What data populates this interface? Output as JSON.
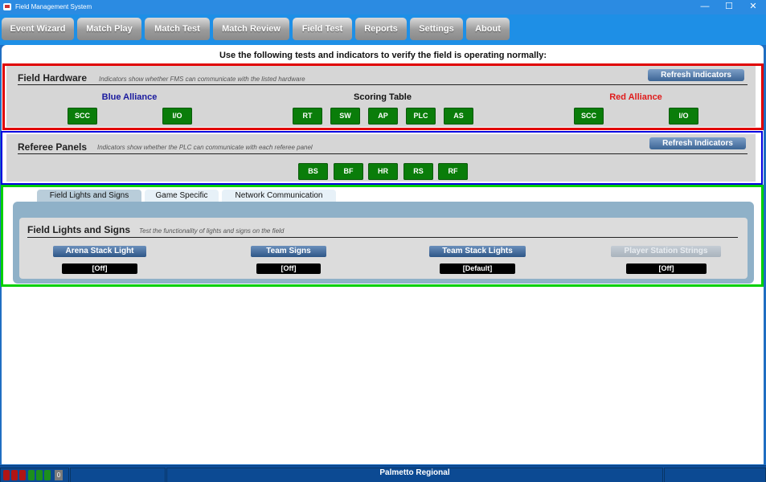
{
  "window": {
    "title": "Field Management System",
    "minimize_glyph": "—",
    "maximize_glyph": "☐",
    "close_glyph": "✕"
  },
  "nav": {
    "items": [
      "Event Wizard",
      "Match Play",
      "Match Test",
      "Match Review",
      "Field Test",
      "Reports",
      "Settings",
      "About"
    ],
    "active": "Field Test"
  },
  "instructions": "Use the following tests and indicators to verify the field is operating normally:",
  "field_hardware": {
    "title": "Field Hardware",
    "subtitle": "Indicators show whether FMS can communicate with the listed hardware",
    "refresh_label": "Refresh Indicators",
    "blue_alliance": {
      "label": "Blue Alliance",
      "color": "#1a1a9e",
      "indicators": [
        "SCC",
        "I/O"
      ]
    },
    "scoring_table": {
      "label": "Scoring Table",
      "indicators": [
        "RT",
        "SW",
        "AP",
        "PLC",
        "AS"
      ]
    },
    "red_alliance": {
      "label": "Red Alliance",
      "color": "#e01b1b",
      "indicators": [
        "SCC",
        "I/O"
      ]
    }
  },
  "referee_panels": {
    "title": "Referee Panels",
    "subtitle": "Indicators show whether the PLC can communicate with each referee panel",
    "refresh_label": "Refresh Indicators",
    "indicators": [
      "BS",
      "BF",
      "HR",
      "RS",
      "RF"
    ]
  },
  "tabs": [
    {
      "label": "Field Lights and Signs",
      "active": true
    },
    {
      "label": "Game Specific",
      "active": false
    },
    {
      "label": "Network Communication",
      "active": false
    }
  ],
  "field_lights": {
    "title": "Field Lights and Signs",
    "subtitle": "Test the functionality of lights and signs on the field",
    "controls": [
      {
        "label": "Arena Stack Light",
        "value": "[Off]",
        "enabled": true
      },
      {
        "label": "Team Signs",
        "value": "[Off]",
        "enabled": true
      },
      {
        "label": "Team Stack Lights",
        "value": "[Default]",
        "enabled": true
      },
      {
        "label": "Player Station Strings",
        "value": "[Off]",
        "enabled": false
      }
    ]
  },
  "status_bar": {
    "event_name": "Palmetto Regional",
    "counter": "0",
    "leds": [
      "#b11515",
      "#b11515",
      "#1d8f1d",
      "#1d8f1d",
      "#1d8f1d",
      "#1d8f1d"
    ]
  },
  "outline_colors": {
    "hardware": "#e00000",
    "referee": "#0000e0",
    "lights": "#00d000"
  }
}
